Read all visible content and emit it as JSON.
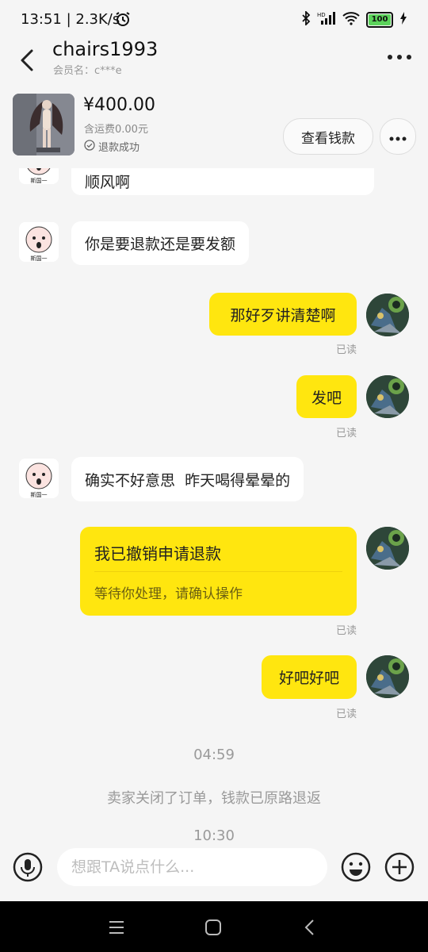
{
  "status_bar": {
    "time_speed": "13:51 | 2.3K/s",
    "battery": "100"
  },
  "header": {
    "title": "chairs1993",
    "member": "会员名：c***e"
  },
  "product": {
    "price": "¥400.00",
    "shipping": "含运费0.00元",
    "status": "退款成功",
    "view_button": "查看钱款"
  },
  "chat": {
    "messages": [
      {
        "side": "left",
        "text": "顺风啊"
      },
      {
        "side": "left",
        "text": "你是要退款还是要发额"
      },
      {
        "side": "right",
        "text": "那好歹讲清楚啊",
        "read": "已读"
      },
      {
        "side": "right",
        "text": "发吧",
        "read": "已读"
      },
      {
        "side": "left",
        "text": "确实不好意思  昨天喝得晕晕的"
      },
      {
        "side": "right",
        "card_title": "我已撤销申请退款",
        "card_sub": "等待你处理，请确认操作",
        "read": "已读"
      },
      {
        "side": "right",
        "text": "好吧好吧",
        "read": "已读"
      }
    ],
    "time1": "04:59",
    "system": "卖家关闭了订单，钱款已原路退返",
    "time2": "10:30",
    "avatar_caption": "斯国一"
  },
  "input": {
    "placeholder": "想跟TA说点什么..."
  },
  "icons": {
    "back": "back-arrow-icon",
    "more": "more-dots-icon",
    "mic": "voice-icon",
    "emoji": "emoji-icon",
    "plus": "plus-icon"
  },
  "colors": {
    "bubble_self": "#ffe60f",
    "background": "#f5f5f5"
  }
}
